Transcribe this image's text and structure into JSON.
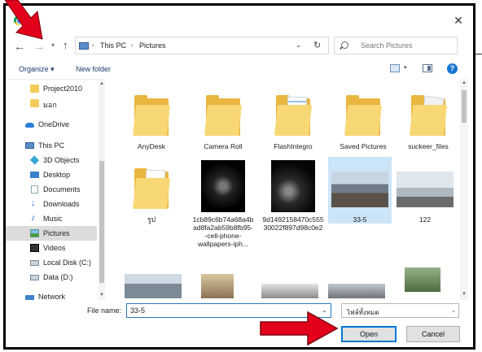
{
  "dialog": {
    "close_glyph": "✕"
  },
  "nav": {
    "back_glyph": "←",
    "forward_glyph": "→",
    "recent_glyph": "▾",
    "up_glyph": "↑"
  },
  "address": {
    "crumbs": [
      "This PC",
      "Pictures"
    ],
    "separator": "›",
    "dropdown_glyph": "⌄",
    "refresh_glyph": "↻"
  },
  "search": {
    "placeholder": "Search Pictures"
  },
  "toolbar": {
    "organize_label": "Organize ▾",
    "new_folder_label": "New folder",
    "view_arrow": "▾",
    "help_label": "?"
  },
  "sidebar": {
    "items": [
      {
        "label": "Project2010",
        "icon": "folder-icon"
      },
      {
        "label": "มอก",
        "icon": "folder-icon"
      },
      {
        "label": "OneDrive",
        "icon": "onedrive-icon"
      },
      {
        "label": "This PC",
        "icon": "computer-icon"
      },
      {
        "label": "3D Objects",
        "icon": "cube-icon"
      },
      {
        "label": "Desktop",
        "icon": "desktop-icon"
      },
      {
        "label": "Documents",
        "icon": "document-icon"
      },
      {
        "label": "Downloads",
        "icon": "download-icon"
      },
      {
        "label": "Music",
        "icon": "music-icon"
      },
      {
        "label": "Pictures",
        "icon": "pictures-icon",
        "selected": true
      },
      {
        "label": "Videos",
        "icon": "video-icon"
      },
      {
        "label": "Local Disk (C:)",
        "icon": "disk-icon"
      },
      {
        "label": "Data (D:)",
        "icon": "disk-icon"
      },
      {
        "label": "Network",
        "icon": "network-icon"
      }
    ],
    "scroll_up": "▲",
    "scroll_down": "▼"
  },
  "files": {
    "items": [
      {
        "label": "AnyDesk",
        "kind": "folder"
      },
      {
        "label": "Camera Roll",
        "kind": "folder"
      },
      {
        "label": "FlashIntegro",
        "kind": "folder"
      },
      {
        "label": "Saved Pictures",
        "kind": "folder"
      },
      {
        "label": "suckeer_files",
        "kind": "folder"
      },
      {
        "label": "รูป",
        "kind": "folder"
      },
      {
        "label": "1cb89c6b74a68a4bad8fa2ab59b8fb95--cell-phone-wallpapers-iph...",
        "kind": "image"
      },
      {
        "label": "9d1492158470c55530022f897d98c0e2",
        "kind": "image"
      },
      {
        "label": "33-5",
        "kind": "image",
        "selected": true
      },
      {
        "label": "122",
        "kind": "image"
      }
    ],
    "scroll_up": "▲",
    "scroll_down": "▼"
  },
  "footer": {
    "filename_label": "File name:",
    "filename_value": "33-5",
    "filename_dropdown": "⌄",
    "filetype_value": "ไฟล์ทั้งหมด",
    "filetype_arrow": "⌄",
    "open_label": "Open",
    "cancel_label": "Cancel"
  },
  "annotation": {
    "arrow_color": "#e3001b"
  }
}
